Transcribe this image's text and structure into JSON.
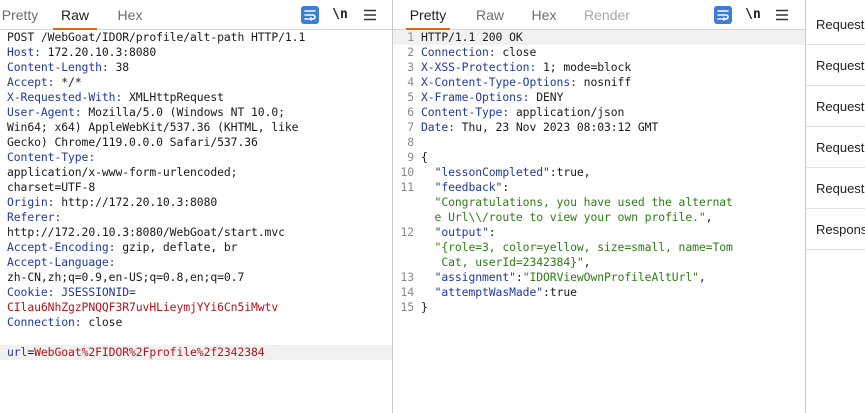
{
  "request": {
    "tabs": [
      "Pretty",
      "Raw",
      "Hex"
    ],
    "active_tab": "Raw",
    "toggle_newline_label": "\\n",
    "lines": [
      {
        "parts": [
          {
            "t": "POST /WebGoat/IDOR/profile/alt-path HTTP/1.1",
            "c": "plain"
          }
        ]
      },
      {
        "parts": [
          {
            "t": "Host: ",
            "c": "hkey"
          },
          {
            "t": "172.20.10.3:8080",
            "c": "hval"
          }
        ]
      },
      {
        "parts": [
          {
            "t": "Content-Length: ",
            "c": "hkey"
          },
          {
            "t": "38",
            "c": "hval"
          }
        ]
      },
      {
        "parts": [
          {
            "t": "Accept: ",
            "c": "hkey"
          },
          {
            "t": "*/*",
            "c": "hval"
          }
        ]
      },
      {
        "parts": [
          {
            "t": "X-Requested-With: ",
            "c": "hkey"
          },
          {
            "t": "XMLHttpRequest",
            "c": "hval"
          }
        ]
      },
      {
        "parts": [
          {
            "t": "User-Agent: ",
            "c": "hkey"
          },
          {
            "t": "Mozilla/5.0 (Windows NT 10.0;",
            "c": "hval"
          }
        ]
      },
      {
        "parts": [
          {
            "t": "Win64; x64) AppleWebKit/537.36 (KHTML, like",
            "c": "hval"
          }
        ]
      },
      {
        "parts": [
          {
            "t": "Gecko) Chrome/119.0.0.0 Safari/537.36",
            "c": "hval"
          }
        ]
      },
      {
        "parts": [
          {
            "t": "Content-Type:",
            "c": "hkey"
          }
        ]
      },
      {
        "parts": [
          {
            "t": "application/x-www-form-urlencoded;",
            "c": "hval"
          }
        ]
      },
      {
        "parts": [
          {
            "t": "charset=UTF-8",
            "c": "hval"
          }
        ]
      },
      {
        "parts": [
          {
            "t": "Origin: ",
            "c": "hkey"
          },
          {
            "t": "http://172.20.10.3:8080",
            "c": "hval"
          }
        ]
      },
      {
        "parts": [
          {
            "t": "Referer:",
            "c": "hkey"
          }
        ]
      },
      {
        "parts": [
          {
            "t": "http://172.20.10.3:8080/WebGoat/start.mvc",
            "c": "hval"
          }
        ]
      },
      {
        "parts": [
          {
            "t": "Accept-Encoding: ",
            "c": "hkey"
          },
          {
            "t": "gzip, deflate, br",
            "c": "hval"
          }
        ]
      },
      {
        "parts": [
          {
            "t": "Accept-Language:",
            "c": "hkey"
          }
        ]
      },
      {
        "parts": [
          {
            "t": "zh-CN,zh;q=0.9,en-US;q=0.8,en;q=0.7",
            "c": "hval"
          }
        ]
      },
      {
        "parts": [
          {
            "t": "Cookie: ",
            "c": "hkey"
          },
          {
            "t": "JSESSIONID=",
            "c": "blue"
          }
        ]
      },
      {
        "parts": [
          {
            "t": "CIlau6NhZgzPNQQF3R7uvHLieymjYYi6Cn5iMwtv",
            "c": "red"
          }
        ]
      },
      {
        "parts": [
          {
            "t": "Connection: ",
            "c": "hkey"
          },
          {
            "t": "close",
            "c": "hval"
          }
        ]
      },
      {
        "parts": [
          {
            "t": "",
            "c": "plain"
          }
        ]
      },
      {
        "parts": [
          {
            "t": "url",
            "c": "blue"
          },
          {
            "t": "=",
            "c": "plain"
          },
          {
            "t": "WebGoat%2FIDOR%2Fprofile%2f2342384",
            "c": "red"
          }
        ],
        "highlight": true
      }
    ]
  },
  "response": {
    "tabs": [
      "Pretty",
      "Raw",
      "Hex",
      "Render"
    ],
    "active_tab": "Pretty",
    "toggle_newline_label": "\\n",
    "lines": [
      {
        "n": "1",
        "parts": [
          {
            "t": "HTTP/1.1 200 OK",
            "c": "plain"
          }
        ],
        "highlight": true
      },
      {
        "n": "2",
        "parts": [
          {
            "t": "Connection: ",
            "c": "hkey"
          },
          {
            "t": "close",
            "c": "hval"
          }
        ]
      },
      {
        "n": "3",
        "parts": [
          {
            "t": "X-XSS-Protection: ",
            "c": "hkey"
          },
          {
            "t": "1; mode=block",
            "c": "hval"
          }
        ]
      },
      {
        "n": "4",
        "parts": [
          {
            "t": "X-Content-Type-Options: ",
            "c": "hkey"
          },
          {
            "t": "nosniff",
            "c": "hval"
          }
        ]
      },
      {
        "n": "5",
        "parts": [
          {
            "t": "X-Frame-Options: ",
            "c": "hkey"
          },
          {
            "t": "DENY",
            "c": "hval"
          }
        ]
      },
      {
        "n": "6",
        "parts": [
          {
            "t": "Content-Type: ",
            "c": "hkey"
          },
          {
            "t": "application/json",
            "c": "hval"
          }
        ]
      },
      {
        "n": "7",
        "parts": [
          {
            "t": "Date: ",
            "c": "hkey"
          },
          {
            "t": "Thu, 23 Nov 2023 08:03:12 GMT",
            "c": "hval"
          }
        ]
      },
      {
        "n": "8",
        "parts": [
          {
            "t": "",
            "c": "plain"
          }
        ]
      },
      {
        "n": "9",
        "parts": [
          {
            "t": "{",
            "c": "plain"
          }
        ]
      },
      {
        "n": "10",
        "parts": [
          {
            "t": "  ",
            "c": "plain"
          },
          {
            "t": "\"lessonCompleted\"",
            "c": "blue"
          },
          {
            "t": ":true,",
            "c": "plain"
          }
        ]
      },
      {
        "n": "11",
        "parts": [
          {
            "t": "  ",
            "c": "plain"
          },
          {
            "t": "\"feedback\"",
            "c": "blue"
          },
          {
            "t": ":",
            "c": "plain"
          }
        ]
      },
      {
        "n": "",
        "parts": [
          {
            "t": "  \"Congratulations, you have used the alternat",
            "c": "green"
          }
        ]
      },
      {
        "n": "",
        "parts": [
          {
            "t": "  e Url\\\\/route to view your own profile.\"",
            "c": "green"
          },
          {
            "t": ",",
            "c": "plain"
          }
        ]
      },
      {
        "n": "12",
        "parts": [
          {
            "t": "  ",
            "c": "plain"
          },
          {
            "t": "\"output\"",
            "c": "blue"
          },
          {
            "t": ":",
            "c": "plain"
          }
        ]
      },
      {
        "n": "",
        "parts": [
          {
            "t": "  \"{role=3, color=yellow, size=small, name=Tom",
            "c": "green"
          }
        ]
      },
      {
        "n": "",
        "parts": [
          {
            "t": "   Cat, userId=2342384}\"",
            "c": "green"
          },
          {
            "t": ",",
            "c": "plain"
          }
        ]
      },
      {
        "n": "13",
        "parts": [
          {
            "t": "  ",
            "c": "plain"
          },
          {
            "t": "\"assignment\"",
            "c": "blue"
          },
          {
            "t": ":",
            "c": "plain"
          },
          {
            "t": "\"IDORViewOwnProfileAltUrl\"",
            "c": "green"
          },
          {
            "t": ",",
            "c": "plain"
          }
        ]
      },
      {
        "n": "14",
        "parts": [
          {
            "t": "  ",
            "c": "plain"
          },
          {
            "t": "\"attemptWasMade\"",
            "c": "blue"
          },
          {
            "t": ":true",
            "c": "plain"
          }
        ]
      },
      {
        "n": "15",
        "parts": [
          {
            "t": "}",
            "c": "plain"
          }
        ]
      }
    ]
  },
  "side_list": [
    "Request",
    "Request",
    "Request",
    "Request",
    "Request",
    "Respons"
  ],
  "colors": {
    "accent_underline": "#e8650f",
    "wrap_button": "#3b7dd8",
    "header_key": "#203a9e",
    "string": "#2e7d16",
    "cookie_value": "#b3131b"
  },
  "icons": {
    "wrap": "wrap-lines-icon",
    "menu": "hamburger-menu-icon"
  }
}
